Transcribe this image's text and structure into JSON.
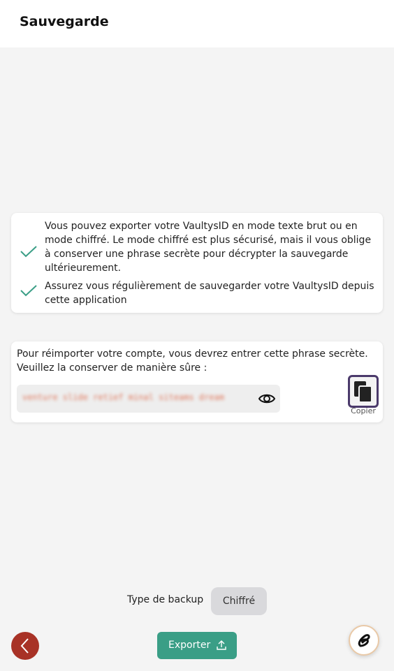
{
  "header": {
    "title": "Sauvegarde"
  },
  "info": {
    "items": [
      {
        "text": "Vous pouvez exporter votre VaultysID en mode texte brut ou en mode chiffré. Le mode chiffré est plus sécurisé, mais il vous oblige à conserver une phrase secrète pour décrypter la sauvegarde ultérieurement.",
        "icon": "check-icon"
      },
      {
        "text": "Assurez vous régulièrement de sauvegarder votre VaultysID depuis cette application",
        "icon": "check-icon"
      }
    ]
  },
  "secret": {
    "description": "Pour réimporter votre compte, vous devrez entrer cette phrase secrète. Veuillez la conserver de manière sûre :",
    "value": "venture slide retief minal siteams dream",
    "copy_label": "Copier",
    "visibility_icon": "eye-icon",
    "copy_icon": "copy-icon"
  },
  "backup": {
    "type_label": "Type de backup",
    "type_value": "Chiffré"
  },
  "actions": {
    "export_label": "Exporter",
    "export_icon": "upload-icon",
    "back_icon": "chevron-left-icon",
    "fab_icon": "vaultys-logo-icon"
  },
  "colors": {
    "accent": "#3a9e86",
    "check": "#3a9e86",
    "back": "#a83226",
    "copy_border": "#4b3a6b",
    "secret_blur": "#e07a5f"
  }
}
